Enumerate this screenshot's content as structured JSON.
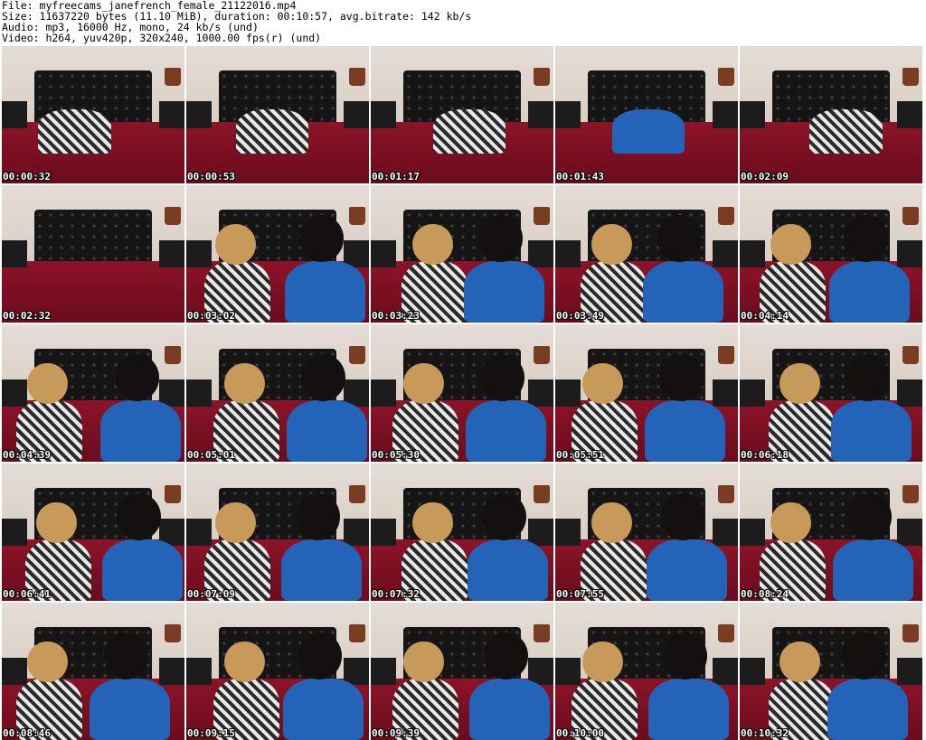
{
  "header": {
    "file": "File: myfreecams_janefrench_female_21122016.mp4",
    "size": "Size: 11637220 bytes (11.10 MiB), duration: 00:10:57, avg.bitrate: 142 kb/s",
    "audio": "Audio: mp3, 16000 Hz, mono, 24 kb/s (und)",
    "video": "Video: h264, yuv420p, 320x240, 1000.00 fps(r) (und)"
  },
  "thumbnails": [
    {
      "time": "00:00:32"
    },
    {
      "time": "00:00:53"
    },
    {
      "time": "00:01:17"
    },
    {
      "time": "00:01:43"
    },
    {
      "time": "00:02:09"
    },
    {
      "time": "00:02:32"
    },
    {
      "time": "00:03:02"
    },
    {
      "time": "00:03:23"
    },
    {
      "time": "00:03:49"
    },
    {
      "time": "00:04:14"
    },
    {
      "time": "00:04:39"
    },
    {
      "time": "00:05:01"
    },
    {
      "time": "00:05:30"
    },
    {
      "time": "00:05:51"
    },
    {
      "time": "00:06:18"
    },
    {
      "time": "00:06:41"
    },
    {
      "time": "00:07:09"
    },
    {
      "time": "00:07:32"
    },
    {
      "time": "00:07:55"
    },
    {
      "time": "00:08:24"
    },
    {
      "time": "00:08:46"
    },
    {
      "time": "00:09:15"
    },
    {
      "time": "00:09:39"
    },
    {
      "time": "00:10:00"
    },
    {
      "time": "00:10:32"
    }
  ]
}
